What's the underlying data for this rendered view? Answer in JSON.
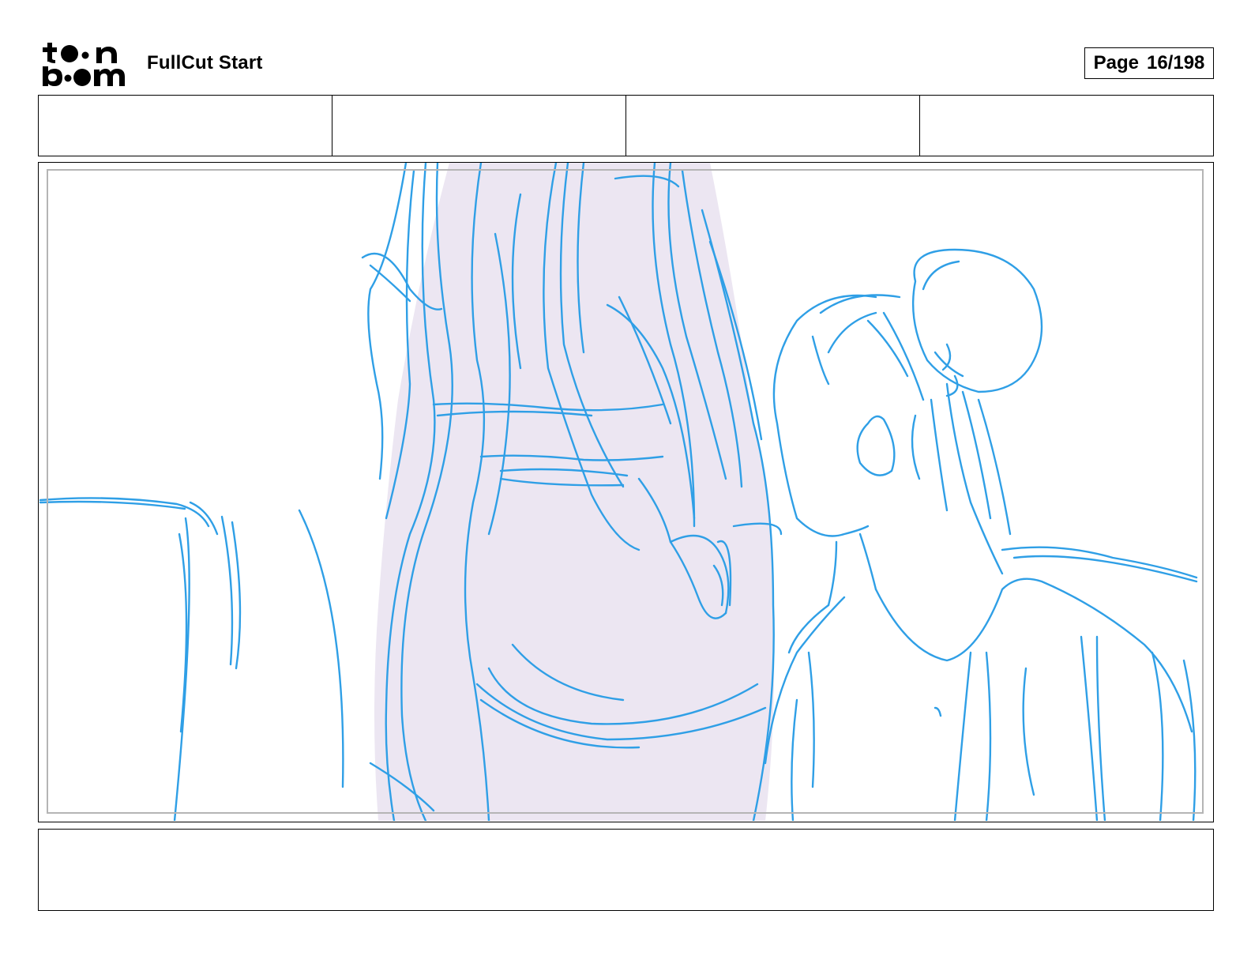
{
  "header": {
    "logo_text": "toonboom",
    "project_title": "FullCut Start",
    "page_label": "Page",
    "page_number": "16/198"
  },
  "info_row": {
    "cells": [
      "",
      "",
      "",
      ""
    ]
  },
  "panel": {
    "sketch_color": "#2f9fe6",
    "fill_color": "#ece6f2",
    "frame_color": "#b5b5b5"
  },
  "notes": {
    "text": ""
  }
}
